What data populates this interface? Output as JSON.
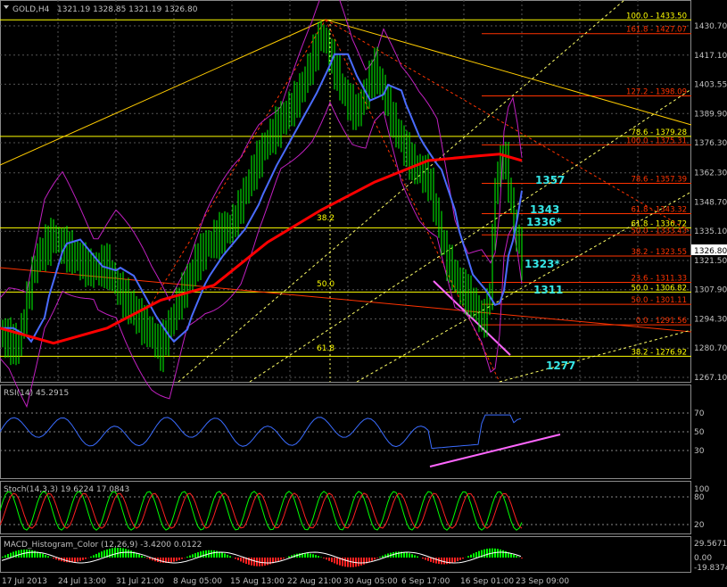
{
  "header": {
    "symbol": "GOLD,H4",
    "ohlc": "1321.19 1328.85 1321.19 1326.80"
  },
  "price_axis": [
    "1430.70",
    "1417.10",
    "1403.55",
    "1389.90",
    "1376.30",
    "1362.30",
    "1348.70",
    "1335.10",
    "1321.50",
    "1307.90",
    "1294.30",
    "1280.70",
    "1267.10"
  ],
  "current_price": "1326.80",
  "fib_labels": [
    {
      "text": "100.0 - 1433.50",
      "price": 1433.5,
      "color": "#ffff00"
    },
    {
      "text": "161.8 - 1427.07",
      "price": 1427.07,
      "color": "#ff3300"
    },
    {
      "text": "127.2 - 1398.09",
      "price": 1398.09,
      "color": "#ff3300"
    },
    {
      "text": "78.6 - 1379.28",
      "price": 1379.28,
      "color": "#ffff00"
    },
    {
      "text": "100.0 - 1375.31",
      "price": 1375.31,
      "color": "#ff3300"
    },
    {
      "text": "78.6 - 1357.39",
      "price": 1357.39,
      "color": "#ff3300"
    },
    {
      "text": "61.8 - 1343.32",
      "price": 1343.32,
      "color": "#ff3300"
    },
    {
      "text": "61.8 - 1336.72",
      "price": 1336.72,
      "color": "#ffff00"
    },
    {
      "text": "50.0 - 1333.43",
      "price": 1333.43,
      "color": "#ff3300"
    },
    {
      "text": "38.2 - 1323.55",
      "price": 1323.55,
      "color": "#ff3300"
    },
    {
      "text": "23.6 - 1311.33",
      "price": 1311.33,
      "color": "#ff3300"
    },
    {
      "text": "50.0 - 1306.82",
      "price": 1306.82,
      "color": "#ffff00"
    },
    {
      "text": "50.0 - 1301.11",
      "price": 1301.11,
      "color": "#ff3300"
    },
    {
      "text": "0.0 - 1291.56",
      "price": 1291.56,
      "color": "#ff3300"
    },
    {
      "text": "38.2 - 1276.92",
      "price": 1276.92,
      "color": "#ffff00"
    }
  ],
  "left_fib_labels": [
    "38.2",
    "50.0",
    "61.8"
  ],
  "annotations": [
    "1357",
    "1343",
    "1336*",
    "1323*",
    "1311",
    "1277"
  ],
  "rsi": {
    "title": "RSI(14) 45.2915",
    "levels": [
      "70",
      "50",
      "30"
    ]
  },
  "stoch": {
    "title": "Stoch(14,3,3) 19.6224 17.0843",
    "levels": [
      "100",
      "80",
      "20"
    ]
  },
  "macd": {
    "title": "MACD_Histogram_Color (12,26,9) -3.4200 0.0122",
    "levels": [
      "29.5671",
      "0.00",
      "-19.8374"
    ]
  },
  "time_axis": [
    "17 Jul 2013",
    "24 Jul 13:00",
    "31 Jul 21:00",
    "8 Aug 05:00",
    "15 Aug 13:00",
    "22 Aug 21:00",
    "30 Aug 05:00",
    "6 Sep 17:00",
    "16 Sep 01:00",
    "23 Sep 09:00"
  ],
  "colors": {
    "background": "#000000",
    "grid": "#5a5a5a",
    "axis_text": "#c0c0c0",
    "candles": "#00ff00",
    "ma_red": "#ff0000",
    "ma_blue": "#4a6cff",
    "bollinger": "#c020c0",
    "fib_yellow": "#ffff00",
    "fib_red": "#ff3300",
    "annot_cyan": "#36e6e6",
    "trend_pink": "#ff66ff",
    "rsi_line": "#3a6cff"
  }
}
